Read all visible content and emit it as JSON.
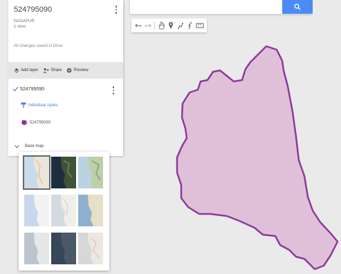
{
  "map_name": "524795090",
  "map_subtitle": "NAGAPUR",
  "map_views": "1 view",
  "saved_status": "All changes saved in Drive",
  "actions": {
    "add_layer": "Add layer",
    "share": "Share",
    "preview": "Preview"
  },
  "layer": {
    "name": "524795090",
    "style_label": "Individual styles",
    "feature_label": "524795090"
  },
  "basemap_label": "Base map",
  "colors": {
    "polygon_fill": "#e0c0d8",
    "polygon_stroke": "#8a3a9a",
    "accent": "#4c8bf5"
  },
  "icons": {
    "search": "search-icon",
    "undo": "undo-icon",
    "redo": "redo-icon",
    "hand": "hand-icon",
    "marker": "marker-icon",
    "line": "draw-line-icon",
    "route": "route-icon",
    "ruler": "ruler-icon"
  }
}
